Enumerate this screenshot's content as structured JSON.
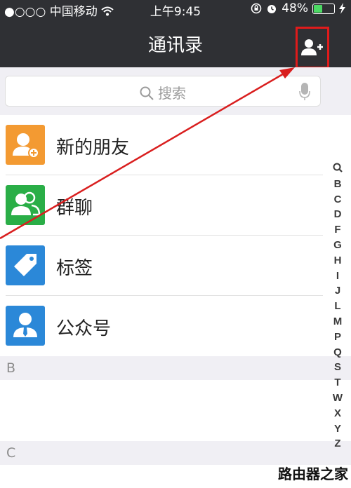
{
  "status_bar": {
    "signal": "●○○○",
    "carrier": "中国移动",
    "wifi_icon": "wifi-icon",
    "time": "上午9:45",
    "battery_percent": "48%",
    "battery_level": 0.48,
    "charging_icon": "bolt-icon"
  },
  "header": {
    "title": "通讯录",
    "add_contact_icon": "add-contact-icon"
  },
  "search": {
    "placeholder": "搜索",
    "mic_icon": "microphone-icon"
  },
  "menu": [
    {
      "label": "新的朋友",
      "color": "#f39a32",
      "icon": "new-friend-icon"
    },
    {
      "label": "群聊",
      "color": "#2aae47",
      "icon": "group-chat-icon"
    },
    {
      "label": "标签",
      "color": "#2b88d8",
      "icon": "tag-icon"
    },
    {
      "label": "公众号",
      "color": "#2b88d8",
      "icon": "official-account-icon"
    }
  ],
  "sections": [
    "B",
    "C"
  ],
  "index_bar": [
    "Q",
    "B",
    "C",
    "D",
    "F",
    "G",
    "H",
    "I",
    "J",
    "L",
    "M",
    "P",
    "Q",
    "S",
    "T",
    "W",
    "X",
    "Y",
    "Z"
  ],
  "watermark": "路由器之家",
  "annotation_color": "#d91e1e"
}
